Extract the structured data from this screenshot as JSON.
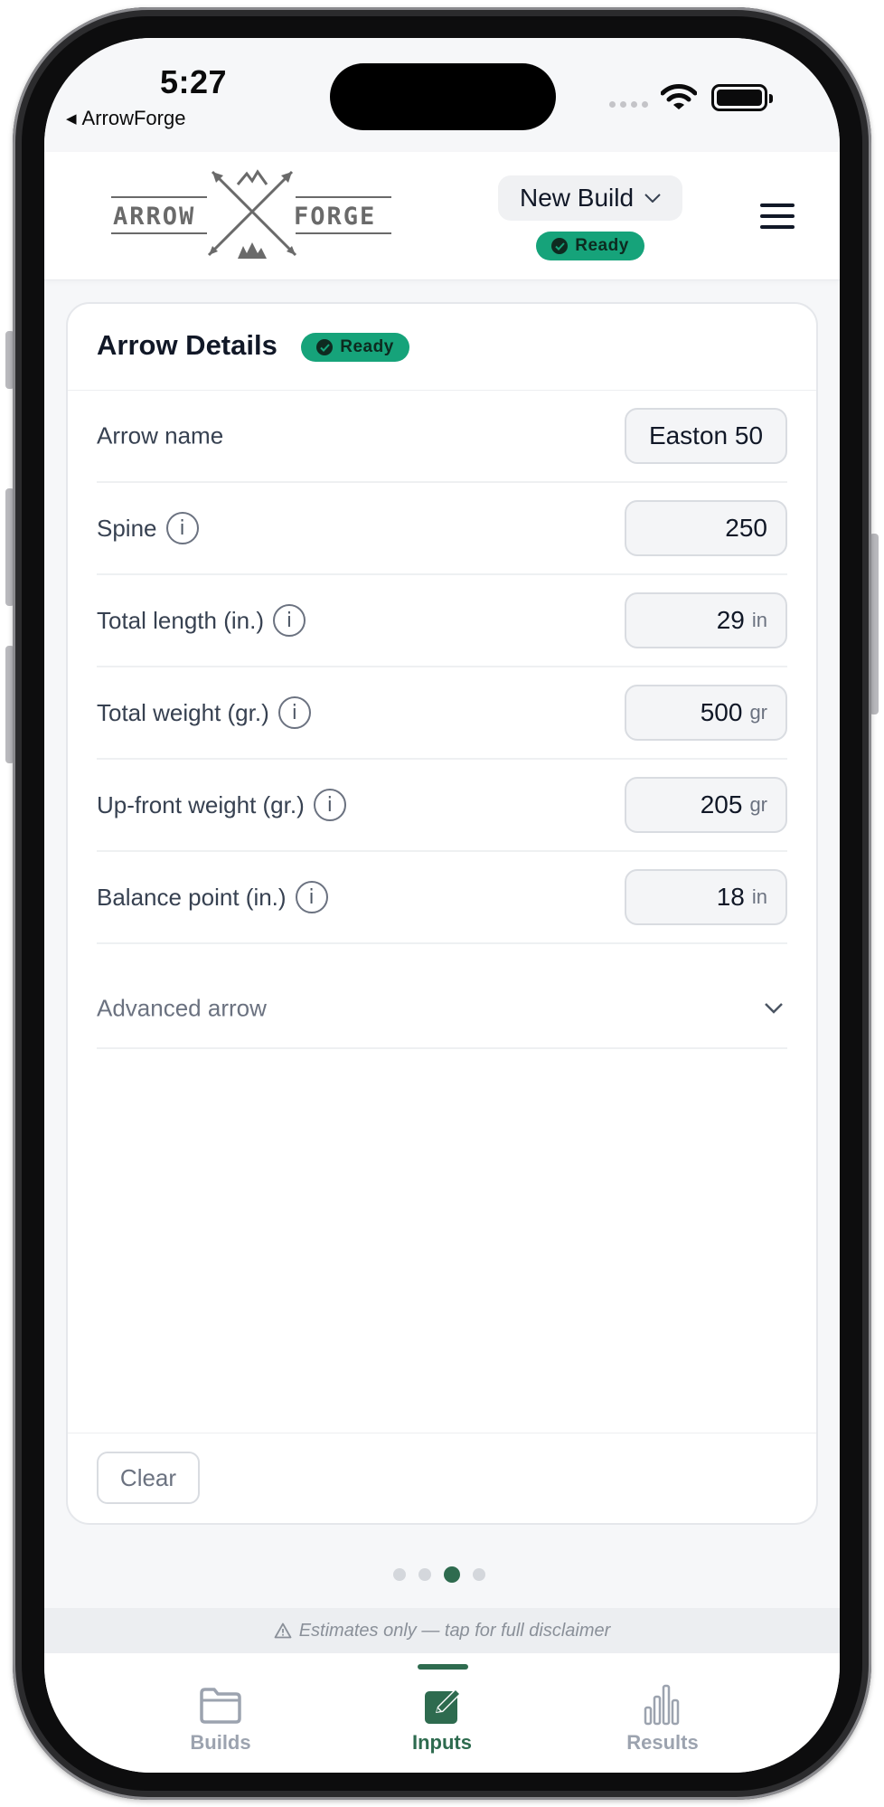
{
  "status_bar": {
    "time": "5:27",
    "back_app": "ArrowForge"
  },
  "header": {
    "logo_left": "ARROW",
    "logo_right": "FORGE",
    "build_selector": "New Build",
    "status_badge": "Ready"
  },
  "card": {
    "title": "Arrow Details",
    "status_badge": "Ready",
    "fields": [
      {
        "label": "Arrow name",
        "value": "Easton 50",
        "unit": "",
        "info": false
      },
      {
        "label": "Spine",
        "value": "250",
        "unit": "",
        "info": true
      },
      {
        "label": "Total length (in.)",
        "value": "29",
        "unit": "in",
        "info": true
      },
      {
        "label": "Total weight (gr.)",
        "value": "500",
        "unit": "gr",
        "info": true
      },
      {
        "label": "Up-front weight (gr.)",
        "value": "205",
        "unit": "gr",
        "info": true
      },
      {
        "label": "Balance point (in.)",
        "value": "18",
        "unit": "in",
        "info": true
      }
    ],
    "info_glyph": "i",
    "advanced_label": "Advanced arrow",
    "clear_button": "Clear"
  },
  "pager": {
    "count": 4,
    "active_index": 2
  },
  "disclaimer": {
    "icon": "warning-icon",
    "text": "Estimates only — tap for full disclaimer"
  },
  "tabs": [
    {
      "label": "Builds",
      "icon": "folder-icon",
      "active": false
    },
    {
      "label": "Inputs",
      "icon": "edit-icon",
      "active": true
    },
    {
      "label": "Results",
      "icon": "bar-chart-icon",
      "active": false
    }
  ],
  "colors": {
    "accent": "#2e6b4f",
    "ready_badge": "#16a37a",
    "inactive_tab": "#9ca3af"
  }
}
